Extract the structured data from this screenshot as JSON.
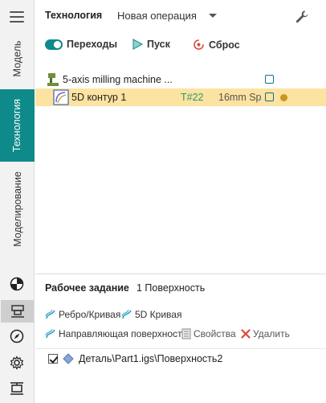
{
  "rail": {
    "tabs": [
      {
        "label": "Модель",
        "active": false
      },
      {
        "label": "Технология",
        "active": true
      },
      {
        "label": "Моделирование",
        "active": false
      }
    ],
    "icons": [
      "half-circle-icon",
      "machine-icon",
      "compass-icon",
      "gear-icon",
      "fixture-icon"
    ]
  },
  "header": {
    "title": "Технология",
    "operation": "Новая операция"
  },
  "toolbar": {
    "transitions_label": "Переходы",
    "run_label": "Пуск",
    "reset_label": "Сброс"
  },
  "tree": {
    "machine": "5-axis milling machine ...",
    "op": {
      "name": "5D контур 1",
      "tool": "T#22",
      "info": "16mm Sp"
    }
  },
  "job": {
    "title": "Рабочее задание",
    "count": "1 Поверхность",
    "buttons": {
      "edge_curve": "Ребро/Кривая",
      "curve5d": "5D Кривая",
      "guide_surface": "Направляющая поверхность",
      "properties": "Свойства",
      "delete": "Удалить"
    },
    "items": [
      {
        "label": "Деталь\\Part1.igs\\Поверхность2",
        "checked": true
      }
    ]
  },
  "colors": {
    "accent": "#0f8a8a",
    "selected_row": "#fde3a1",
    "delete": "#d84a3a",
    "tool_green": "#2a9a6a"
  }
}
